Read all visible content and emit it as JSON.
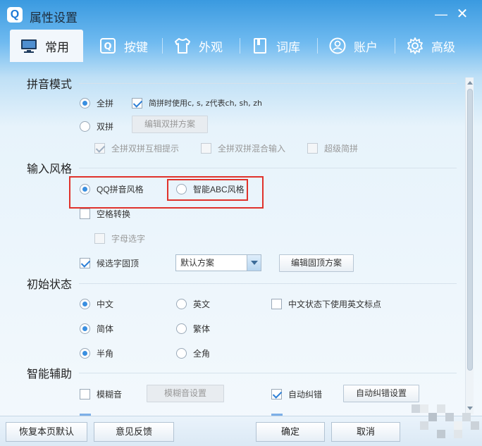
{
  "window": {
    "title": "属性设置",
    "logo_letter": "Q",
    "minimize_glyph": "—",
    "close_glyph": "✕"
  },
  "tabs": [
    {
      "label": "常用",
      "icon": "monitor-icon",
      "active": true
    },
    {
      "label": "按键",
      "icon": "key-icon",
      "active": false
    },
    {
      "label": "外观",
      "icon": "shirt-icon",
      "active": false
    },
    {
      "label": "词库",
      "icon": "book-icon",
      "active": false
    },
    {
      "label": "账户",
      "icon": "user-icon",
      "active": false
    },
    {
      "label": "高级",
      "icon": "gear-icon",
      "active": false
    }
  ],
  "pinyin_mode": {
    "title": "拼音模式",
    "full_pinyin": "全拼",
    "jianpin_option": "简拼时使用c, s, z代表ch, sh, zh",
    "double_pinyin": "双拼",
    "edit_double_button": "编辑双拼方案",
    "mutual_hint": "全拼双拼互相提示",
    "mixed_input": "全拼双拼混合输入",
    "super_jianpin": "超级简拼",
    "selected": "全拼"
  },
  "input_style": {
    "title": "输入风格",
    "qq_style": "QQ拼音风格",
    "abc_style": "智能ABC风格",
    "space_convert": "空格转换",
    "letter_select": "字母选字",
    "fixed_top": "候选字固顶",
    "scheme_select_value": "默认方案",
    "edit_fixed_button": "编辑固顶方案",
    "selected": "QQ拼音风格"
  },
  "initial_state": {
    "title": "初始状态",
    "chinese": "中文",
    "english": "英文",
    "en_punct": "中文状态下使用英文标点",
    "simplified": "简体",
    "traditional": "繁体",
    "half_width": "半角",
    "full_width": "全角"
  },
  "smart_assist": {
    "title": "智能辅助",
    "fuzzy": "模糊音",
    "fuzzy_settings_button": "模糊音设置",
    "auto_correct": "自动纠错",
    "auto_correct_button": "自动纠错设置"
  },
  "footer": {
    "restore_default": "恢复本页默认",
    "feedback": "意见反馈",
    "ok": "确定",
    "cancel": "取消"
  },
  "colors": {
    "accent": "#3a8fe0",
    "highlight_box": "#e0322b",
    "title_bar": "#3a9ae0"
  }
}
